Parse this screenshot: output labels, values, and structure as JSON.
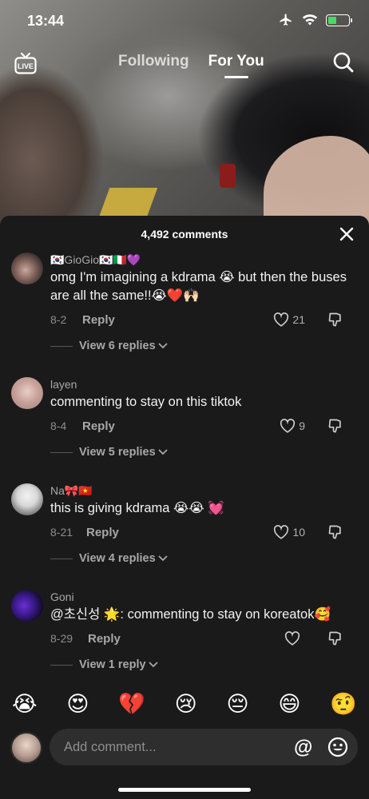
{
  "status_bar": {
    "time": "13:44"
  },
  "nav": {
    "live_label": "LIVE",
    "tabs": [
      "Following",
      "For You"
    ],
    "active_tab": "For You"
  },
  "sheet": {
    "comment_count": "4,492 comments",
    "comments": [
      {
        "user": "🇰🇷GioGio🇰🇷🇮🇹💜",
        "text": "omg I'm imagining a kdrama 😭 but then the buses are all the same!!😭❤️🙌🏻",
        "date": "8-2",
        "reply_label": "Reply",
        "likes": "21",
        "view_replies": "View 6 replies"
      },
      {
        "user": "layen",
        "text": "commenting to stay on this tiktok",
        "date": "8-4",
        "reply_label": "Reply",
        "likes": "9",
        "view_replies": "View 5 replies"
      },
      {
        "user": "Na🎀🇻🇳",
        "text": "this is giving kdrama 😭😭 💓",
        "date": "8-21",
        "reply_label": "Reply",
        "likes": "10",
        "view_replies": "View 4 replies"
      },
      {
        "user": "Goni",
        "text": "@초신성 🌟: commenting to stay on koreatok🥰",
        "date": "8-29",
        "reply_label": "Reply",
        "likes": "",
        "view_replies": "View 1 reply"
      }
    ]
  },
  "emoji_bar": [
    "😭",
    "😍",
    "💔",
    "😢",
    "😔",
    "😄",
    "🤨"
  ],
  "input": {
    "placeholder": "Add comment...",
    "at_label": "@"
  },
  "colors": {
    "sheet_bg": "#1a1a1a",
    "input_bg": "#2e2e2e",
    "like_grey": "#b0b0b0",
    "battery_green": "#4cd964"
  },
  "icons": [
    "live-icon",
    "search-icon",
    "close-icon",
    "heart-icon",
    "dislike-icon",
    "chevron-down-icon",
    "smile-icon",
    "airplane-icon",
    "wifi-icon",
    "battery-icon"
  ]
}
